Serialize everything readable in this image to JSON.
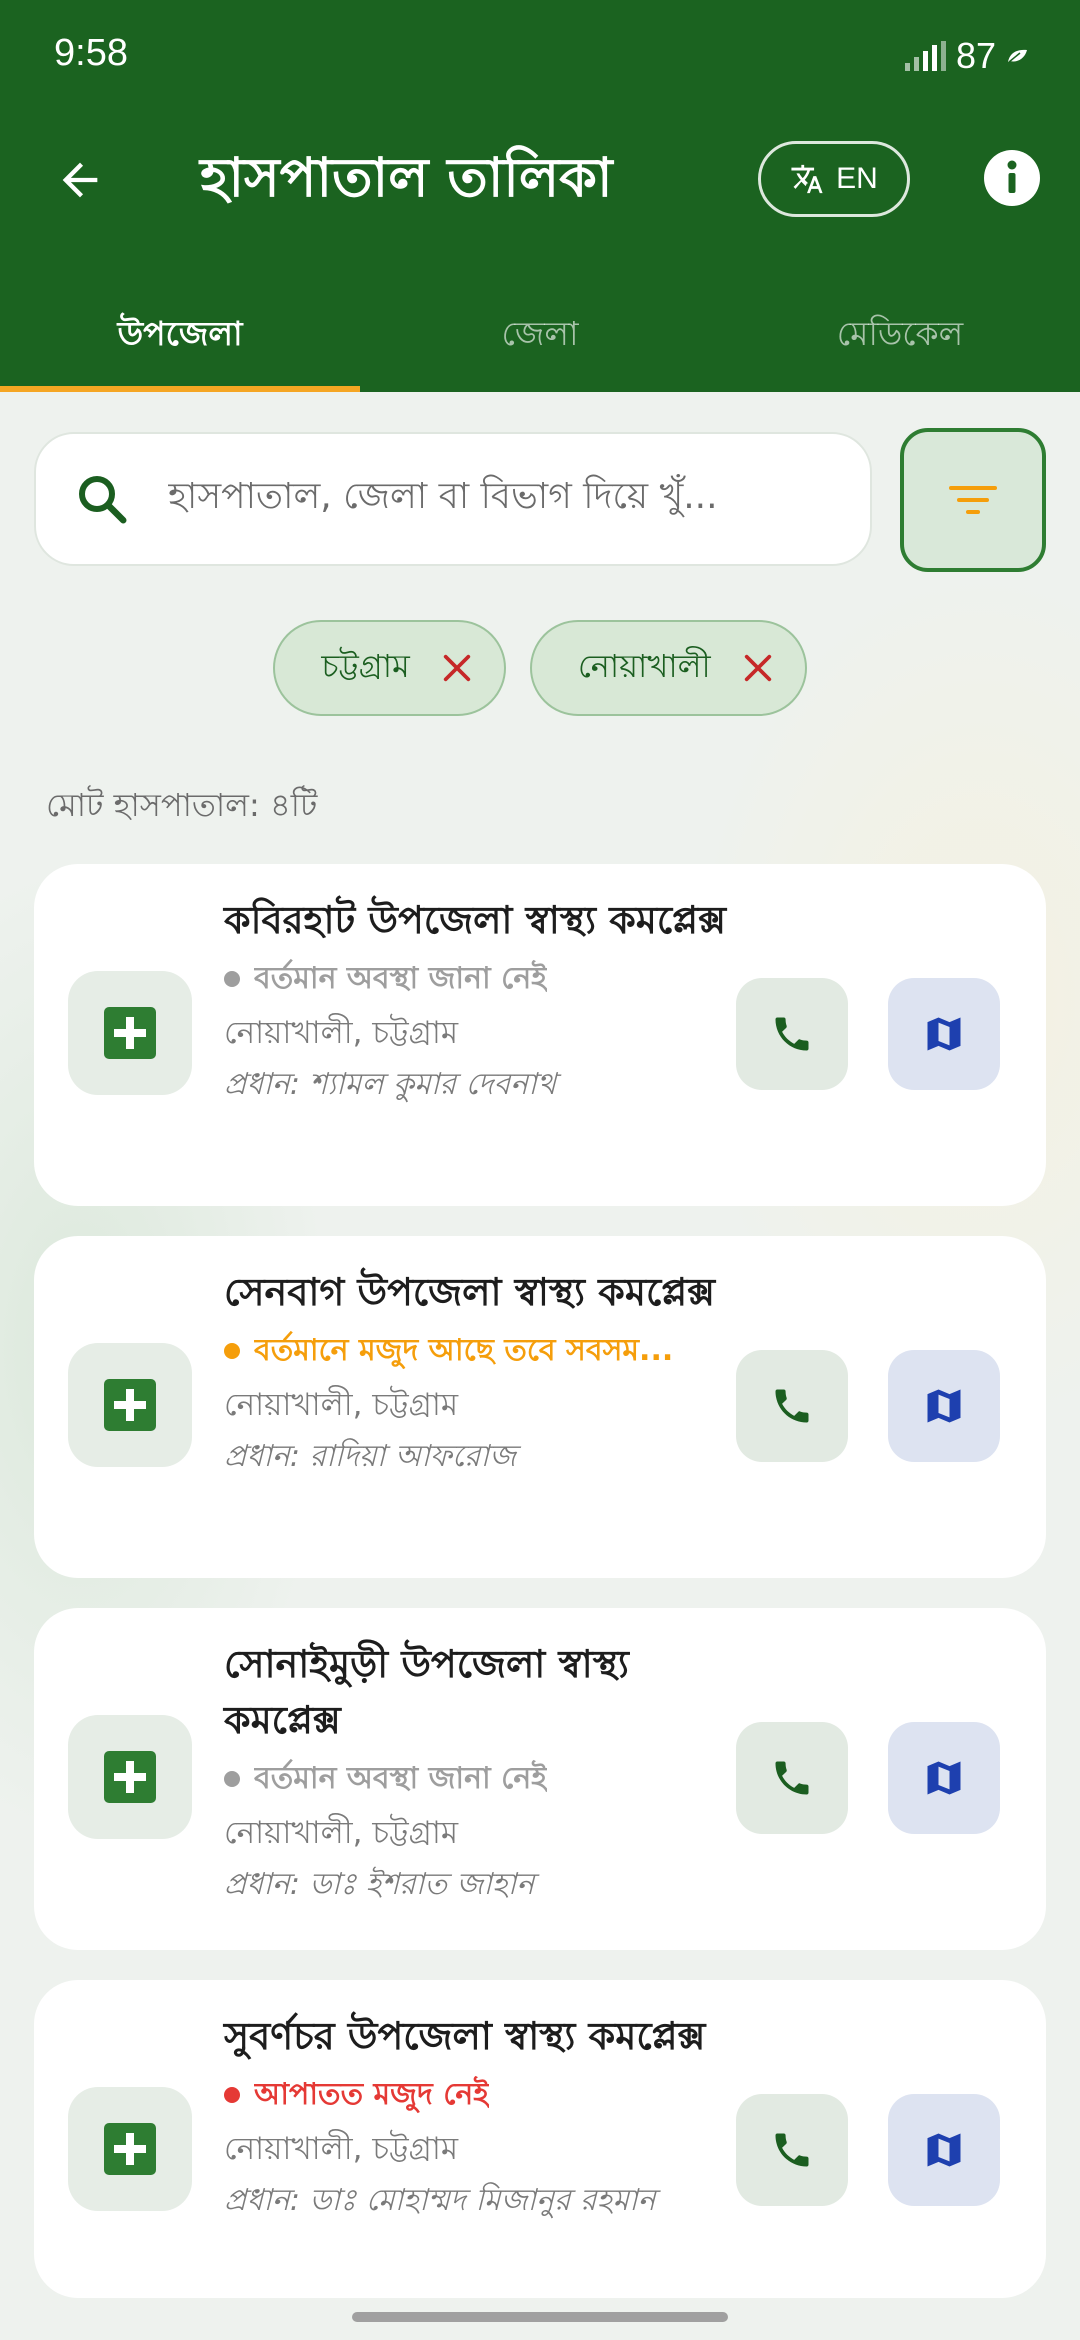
{
  "status_bar": {
    "time": "9:58",
    "battery": "87"
  },
  "header": {
    "title": "হাসপাতাল তালিকা",
    "language_toggle": "EN",
    "back_icon": "arrow-left-icon",
    "info_icon": "info-icon",
    "language_icon": "translate-icon"
  },
  "tabs": [
    {
      "label": "উপজেলা",
      "active": true
    },
    {
      "label": "জেলা",
      "active": false
    },
    {
      "label": "মেডিকেল",
      "active": false
    }
  ],
  "search": {
    "placeholder": "হাসপাতাল, জেলা বা বিভাগ দিয়ে খুঁ..."
  },
  "filter_chips": [
    {
      "label": "চট্টগ্রাম"
    },
    {
      "label": "নোয়াখালী"
    }
  ],
  "total_label": "মোট হাসপাতাল: ৪টি",
  "hospitals": [
    {
      "name": "কবিরহাট উপজেলা স্বাস্থ্য কমপ্লেক্স",
      "status": "বর্তমান অবস্থা জানা নেই",
      "status_color": "#9e9e9e",
      "location": "নোয়াখালী, চট্টগ্রাম",
      "head": "প্রধান: শ্যামল কুমার দেবনাথ"
    },
    {
      "name": "সেনবাগ উপজেলা স্বাস্থ্য কমপ্লেক্স",
      "status": "বর্তমানে মজুদ আছে তবে সবসম...",
      "status_color": "#f59e0b",
      "location": "নোয়াখালী, চট্টগ্রাম",
      "head": "প্রধান: রাদিয়া আফরোজ"
    },
    {
      "name": "সোনাইমুড়ী উপজেলা স্বাস্থ্য কমপ্লেক্স",
      "status": "বর্তমান অবস্থা জানা নেই",
      "status_color": "#9e9e9e",
      "location": "নোয়াখালী, চট্টগ্রাম",
      "head": "প্রধান: ডাঃ ইশরাত জাহান"
    },
    {
      "name": "সুবর্ণচর উপজেলা স্বাস্থ্য কমপ্লেক্স",
      "status": "আপাতত মজুদ নেই",
      "status_color": "#e53935",
      "location": "নোয়াখালী, চট্টগ্রাম",
      "head": "প্রধান: ডাঃ মোহাম্মদ মিজানুর রহমান"
    }
  ],
  "colors": {
    "primary": "#1b6320",
    "tab_indicator": "#f5a623",
    "filter_icon": "#f59e0b",
    "chip_close": "#c62828",
    "map_icon": "#1e40af"
  }
}
